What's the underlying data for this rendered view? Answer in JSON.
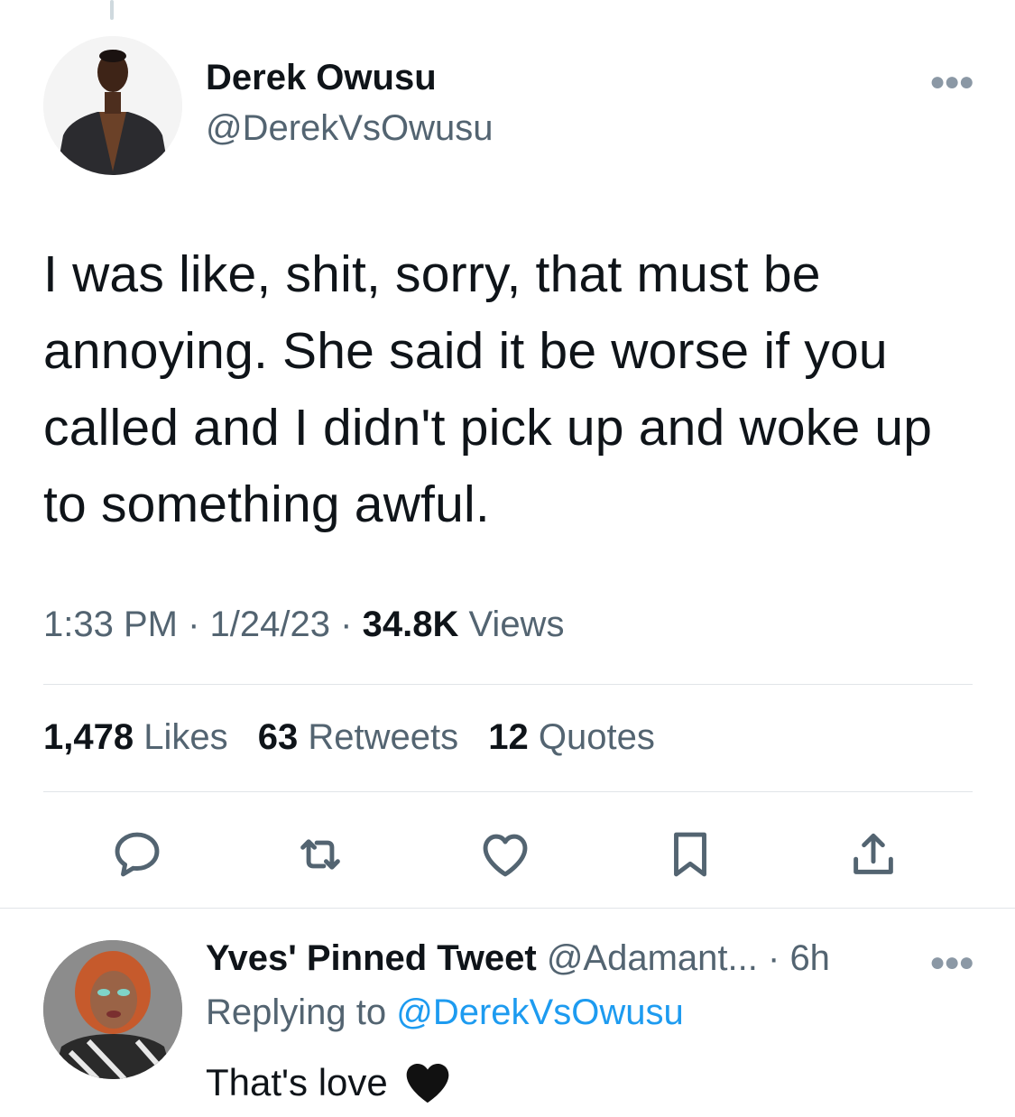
{
  "tweet": {
    "author": {
      "name": "Derek Owusu",
      "handle": "@DerekVsOwusu"
    },
    "more_icon": "more-dots-icon",
    "text": "I was like, shit, sorry, that must be annoying. She said it be worse if you called and I didn't pick up and woke up to something awful.",
    "time": "1:33 PM",
    "sep1": "·",
    "date": "1/24/23",
    "sep2": "·",
    "views_count": "34.8K",
    "views_label": "Views",
    "stats": {
      "likes_count": "1,478",
      "likes_label": "Likes",
      "retweets_count": "63",
      "retweets_label": "Retweets",
      "quotes_count": "12",
      "quotes_label": "Quotes"
    },
    "actions": [
      "reply-icon",
      "retweet-icon",
      "like-icon",
      "bookmark-icon",
      "share-icon"
    ]
  },
  "reply": {
    "author": {
      "name": "Yves' Pinned Tweet",
      "handle": "@Adamant...",
      "sep": "·",
      "time": "6h"
    },
    "replying_prefix": "Replying to",
    "replying_to": "@DerekVsOwusu",
    "text": "That's love",
    "emoji": "black-heart-icon"
  },
  "colors": {
    "text": "#0f1419",
    "secondary": "#536471",
    "link": "#1d9bf0",
    "divider": "#e1e4e8"
  }
}
